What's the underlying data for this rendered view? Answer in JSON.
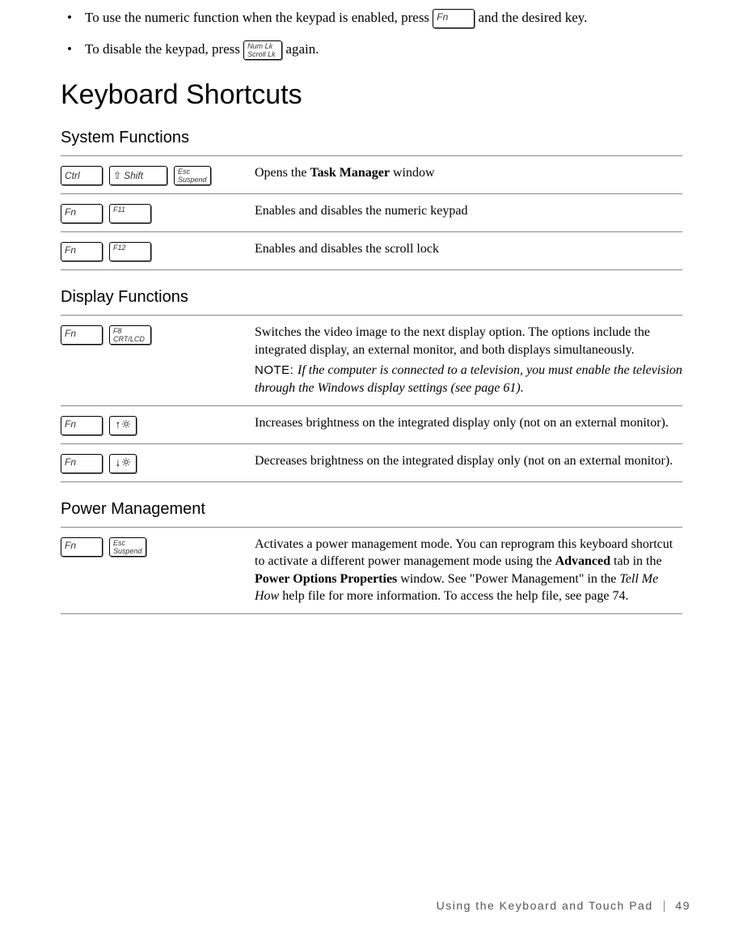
{
  "intro": {
    "bullet1_pre": "To use the numeric function when the keypad is enabled, press ",
    "bullet1_post": " and the desired key.",
    "bullet2_pre": "To disable the keypad, press ",
    "bullet2_post": " again."
  },
  "keys": {
    "fn": "Fn",
    "numlk_top": "Num Lk",
    "numlk_bot": "Scroll Lk",
    "ctrl": "Ctrl",
    "shift": "Shift",
    "esc_top": "Esc",
    "esc_bot": "Suspend",
    "f11": "F11",
    "f12": "F12",
    "f8_top": "F8",
    "f8_bot": "CRT/LCD"
  },
  "heading": "Keyboard Shortcuts",
  "sections": {
    "system": {
      "title": "System Functions",
      "rows": [
        {
          "desc_pre": "Opens the ",
          "bold": "Task Manager",
          "desc_post": " window"
        },
        {
          "desc": "Enables and disables the numeric keypad"
        },
        {
          "desc": "Enables and disables the scroll lock"
        }
      ]
    },
    "display": {
      "title": "Display Functions",
      "rows": [
        {
          "desc": "Switches the video image to the next display option. The options include the integrated display, an external monitor, and both displays simultaneously.",
          "note_label": "NOTE: ",
          "note_text": "If the computer is connected to a television, you must enable the television through the Windows display settings (see page 61)."
        },
        {
          "desc": "Increases brightness on the integrated display only (not on an external monitor)."
        },
        {
          "desc": "Decreases brightness on the integrated display only (not on an external monitor)."
        }
      ]
    },
    "power": {
      "title": "Power Management",
      "rows": [
        {
          "p1": "Activates a power management mode. You can reprogram this keyboard shortcut to activate a different power management mode using the ",
          "b1": "Advanced",
          "p2": " tab in the ",
          "b2": "Power Options Properties",
          "p3": " window. See \"Power Management\" in the ",
          "i1": "Tell Me How",
          "p4": " help file for more information. To access the help file, see page 74."
        }
      ]
    }
  },
  "footer": {
    "text": "Using the Keyboard and Touch Pad",
    "page": "49"
  }
}
